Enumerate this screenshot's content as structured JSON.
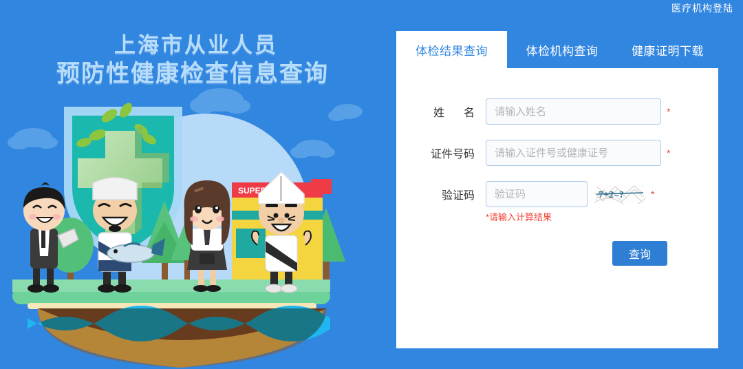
{
  "topbar": {
    "login_link": "医疗机构登陆"
  },
  "hero": {
    "title_line1": "上海市从业人员",
    "title_line2": "预防性健康检查信息查询"
  },
  "illustration": {
    "name": "health-inspection-illustration",
    "shield_label": "health-shield",
    "cross_label": "green-medical-cross",
    "store_sign": "SUPERMA",
    "characters": [
      "waiter",
      "chef-with-fish",
      "waitress",
      "cook"
    ],
    "colors": {
      "background": "#3186e0",
      "shield": "#1bb8ad",
      "shield_outline": "#a8d8f5",
      "cross": "#a5d6a0",
      "ground": "#6ed39a",
      "sand": "#f6e7b8",
      "earth": "#8a5a33",
      "water": "#21b6ef",
      "store": "#f4d53f",
      "sign": "#ef3b46"
    }
  },
  "panel": {
    "tabs": [
      {
        "label": "体检结果查询",
        "active": true
      },
      {
        "label": "体检机构查询",
        "active": false
      },
      {
        "label": "健康证明下载",
        "active": false
      }
    ],
    "form": {
      "name_label": "姓名",
      "name_label_char1": "姓",
      "name_label_char2": "名",
      "name_placeholder": "请输入姓名",
      "name_value": "",
      "id_label": "证件号码",
      "id_placeholder": "请输入证件号或健康证号",
      "id_value": "",
      "captcha_label": "验证码",
      "captcha_placeholder": "验证码",
      "captcha_value": "",
      "captcha_challenge": "7+2=?",
      "required_marker": "*",
      "error_text": "*请输入计算结果",
      "submit_label": "查询"
    },
    "colors": {
      "accent": "#3186e0",
      "button": "#2e7fd4",
      "error": "#f04134",
      "input_border": "#a9c9e8"
    }
  }
}
